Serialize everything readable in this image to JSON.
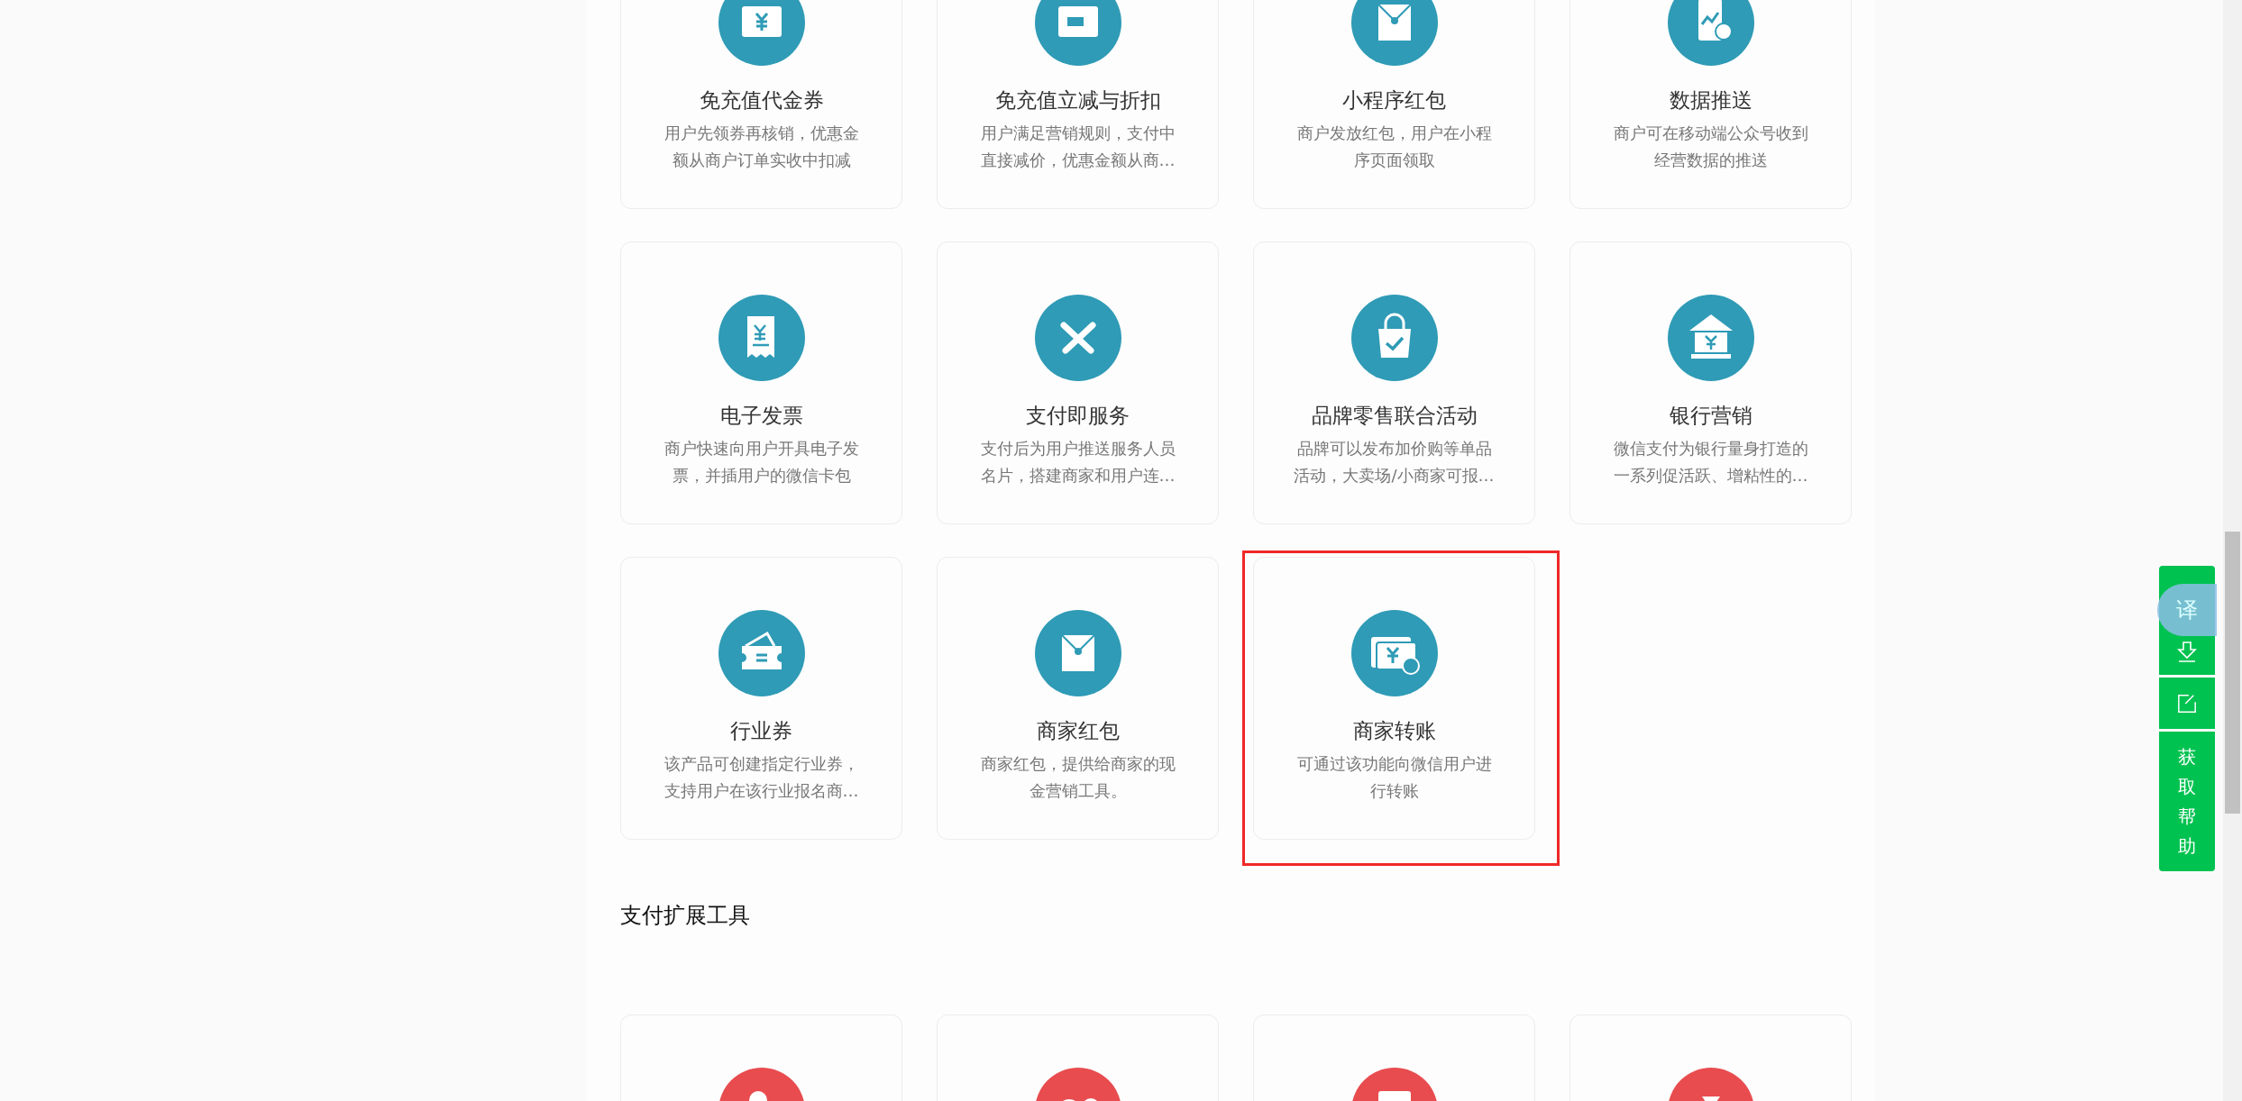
{
  "sections": [
    {
      "color": "#2f9bb6",
      "cards": [
        {
          "title": "免充值代金券",
          "description": "用户先领券再核销，优惠金额从商户订单实收中扣减",
          "highlighted": false
        },
        {
          "title": "免充值立减与折扣",
          "description": "用户满足营销规则，支付中直接减价，优惠金额从商…",
          "highlighted": false
        },
        {
          "title": "小程序红包",
          "description": "商户发放红包，用户在小程序页面领取",
          "highlighted": false
        },
        {
          "title": "数据推送",
          "description": "商户可在移动端公众号收到经营数据的推送",
          "highlighted": false
        },
        {
          "title": "电子发票",
          "description": "商户快速向用户开具电子发票，并插用户的微信卡包",
          "highlighted": false
        },
        {
          "title": "支付即服务",
          "description": "支付后为用户推送服务人员名片，搭建商家和用户连…",
          "highlighted": false
        },
        {
          "title": "品牌零售联合活动",
          "description": "品牌可以发布加价购等单品活动，大卖场/小商家可报…",
          "highlighted": false
        },
        {
          "title": "银行营销",
          "description": "微信支付为银行量身打造的一系列促活跃、增粘性的…",
          "highlighted": false
        },
        {
          "title": "行业券",
          "description": "该产品可创建指定行业券，支持用户在该行业报名商…",
          "highlighted": false
        },
        {
          "title": "商家红包",
          "description": "商家红包，提供给商家的现金营销工具。",
          "highlighted": false
        },
        {
          "title": "商家转账",
          "description": "可通过该功能向微信用户进行转账",
          "highlighted": true
        }
      ]
    },
    {
      "title": "支付扩展工具",
      "color": "#e84c4f",
      "cards": [
        {
          "highlighted": false
        },
        {
          "highlighted": false
        },
        {
          "highlighted": false
        },
        {
          "highlighted": false
        }
      ]
    }
  ],
  "side_toolbar": {
    "translate_label": "译",
    "help_label": "获取帮助"
  }
}
